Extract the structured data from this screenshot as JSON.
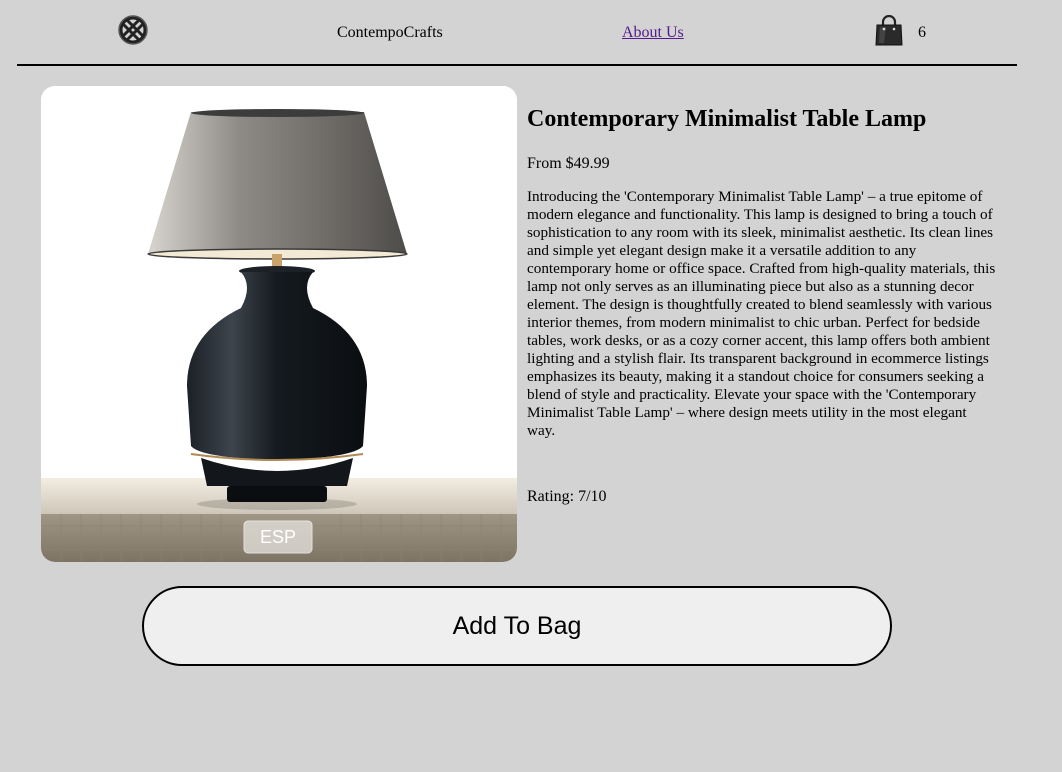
{
  "header": {
    "logo_icon": "woven-knot-logo-icon",
    "brand": "ContempoCrafts",
    "about_label": "About Us",
    "bag_icon": "shopping-bag-icon",
    "bag_count": "6"
  },
  "product": {
    "image_alt": "Contemporary Minimalist Table Lamp",
    "image_watermark": "ESP",
    "title": "Contemporary Minimalist Table Lamp",
    "price": "From $49.99",
    "description": "Introducing the 'Contemporary Minimalist Table Lamp' – a true epitome of modern elegance and functionality. This lamp is designed to bring a touch of sophistication to any room with its sleek, minimalist aesthetic. Its clean lines and simple yet elegant design make it a versatile addition to any contemporary home or office space. Crafted from high-quality materials, this lamp not only serves as an illuminating piece but also as a stunning decor element. The design is thoughtfully created to blend seamlessly with various interior themes, from modern minimalist to chic urban. Perfect for bedside tables, work desks, or as a cozy corner accent, this lamp offers both ambient lighting and a stylish flair. Its transparent background in ecommerce listings emphasizes its beauty, making it a standout choice for consumers seeking a blend of style and practicality. Elevate your space with the 'Contemporary Minimalist Table Lamp' – where design meets utility in the most elegant way.",
    "rating": "Rating: 7/10"
  },
  "actions": {
    "add_to_bag": "Add To Bag"
  },
  "colors": {
    "page_background": "#d3d3d3",
    "link": "#551a8b",
    "button_background": "#efefef"
  }
}
